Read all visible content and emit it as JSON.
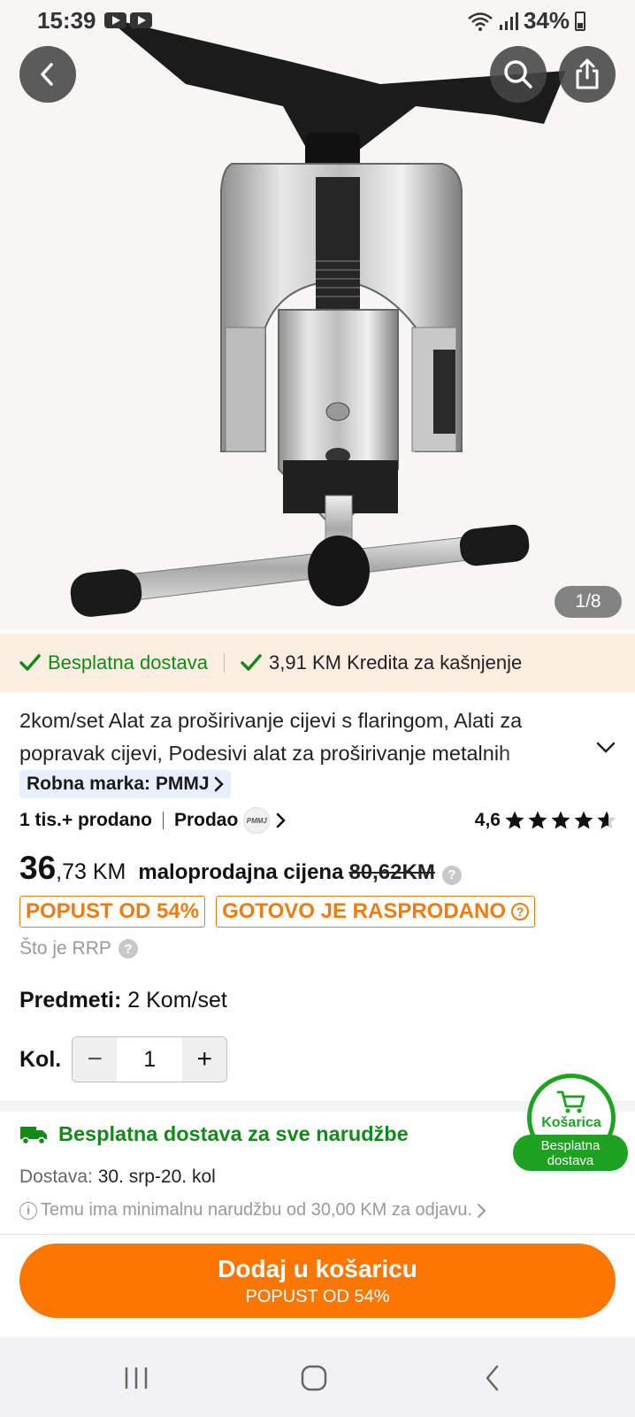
{
  "status_bar": {
    "time": "15:39",
    "battery": "34%"
  },
  "gallery": {
    "counter": "1/8"
  },
  "benefits": {
    "free_shipping": "Besplatna dostava",
    "credit": "3,91 KM Kredita za kašnjenje"
  },
  "product": {
    "title": "2kom/set Alat za proširivanje cijevi s flaringom, Alati za popravak cijevi, Podesivi alat za proširivanje metalnih",
    "brand": "Robna marka: PMMJ",
    "sold": "1 tis.+ prodano",
    "seller_prefix": "Prodao",
    "seller_logo_text": "PMMJ",
    "rating": "4,6",
    "rating_value": 4.6,
    "rating_max": 5
  },
  "price": {
    "main": "36",
    "cents": ",73 KM",
    "rrp_label": "maloprodajna cijena",
    "rrp_value": "80,62KM",
    "discount_badge": "POPUST OD 54%",
    "sold_out_badge": "GOTOVO JE RASPRODANO",
    "what_rrp": "Što je RRP"
  },
  "options": {
    "items_label": "Predmeti:",
    "items_value": "2 Kom/set",
    "qty_label": "Kol.",
    "qty_value": "1",
    "minus": "−",
    "plus": "+"
  },
  "shipping": {
    "headline": "Besplatna dostava za sve narudžbe",
    "delivery_label": "Dostava:",
    "delivery_value": "30. srp-20. kol",
    "min_order": "Temu ima minimalnu narudžbu od 30,00 KM za odjavu."
  },
  "cart_float": {
    "label": "Košarica",
    "pill": "Besplatna dostava"
  },
  "cta": {
    "main": "Dodaj u košaricu",
    "sub": "POPUST OD 54%"
  },
  "colors": {
    "accent_orange": "#fb7701",
    "green": "#138a18",
    "badge_orange": "#f07c10",
    "benefits_bg": "#fdeee2"
  },
  "icons": [
    "back-icon",
    "search-icon",
    "share-icon",
    "check-icon",
    "chevron-down-icon",
    "chevron-right-icon",
    "star-icon",
    "help-icon",
    "truck-icon",
    "info-icon",
    "cart-icon",
    "nav-recents-icon",
    "nav-home-icon",
    "nav-back-icon"
  ]
}
